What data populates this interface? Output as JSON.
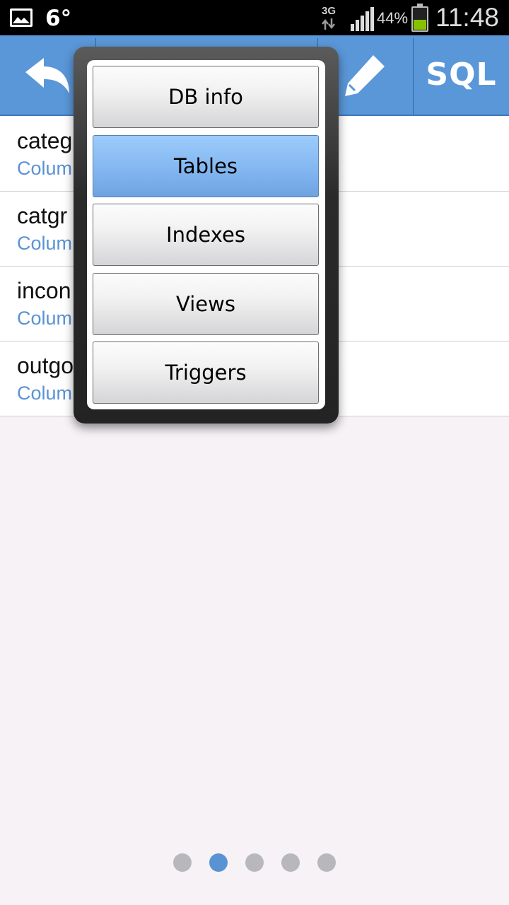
{
  "status_bar": {
    "temperature": "6°",
    "network_type": "3G",
    "battery_percent": "44%",
    "battery_level": 0.44,
    "time": "11:48",
    "icons": [
      "gallery-icon",
      "data-arrows-icon",
      "signal-icon",
      "battery-icon"
    ]
  },
  "toolbar": {
    "back_icon": "back-arrow-icon",
    "edit_icon": "pencil-icon",
    "sql_label": "SQL"
  },
  "list": {
    "items": [
      {
        "name": "categ",
        "subtitle": "Colum"
      },
      {
        "name": "catgr",
        "subtitle": "Colum"
      },
      {
        "name": "incon",
        "subtitle": "Colum"
      },
      {
        "name": "outgo",
        "subtitle": "Colum"
      }
    ]
  },
  "popup_menu": {
    "items": [
      {
        "label": "DB info",
        "selected": false
      },
      {
        "label": "Tables",
        "selected": true
      },
      {
        "label": "Indexes",
        "selected": false
      },
      {
        "label": "Views",
        "selected": false
      },
      {
        "label": "Triggers",
        "selected": false
      }
    ]
  },
  "page_indicator": {
    "count": 5,
    "active_index": 1
  },
  "colors": {
    "toolbar": "#5a97d8",
    "accent": "#5a93d4",
    "selected_item": "#86b9f2"
  }
}
